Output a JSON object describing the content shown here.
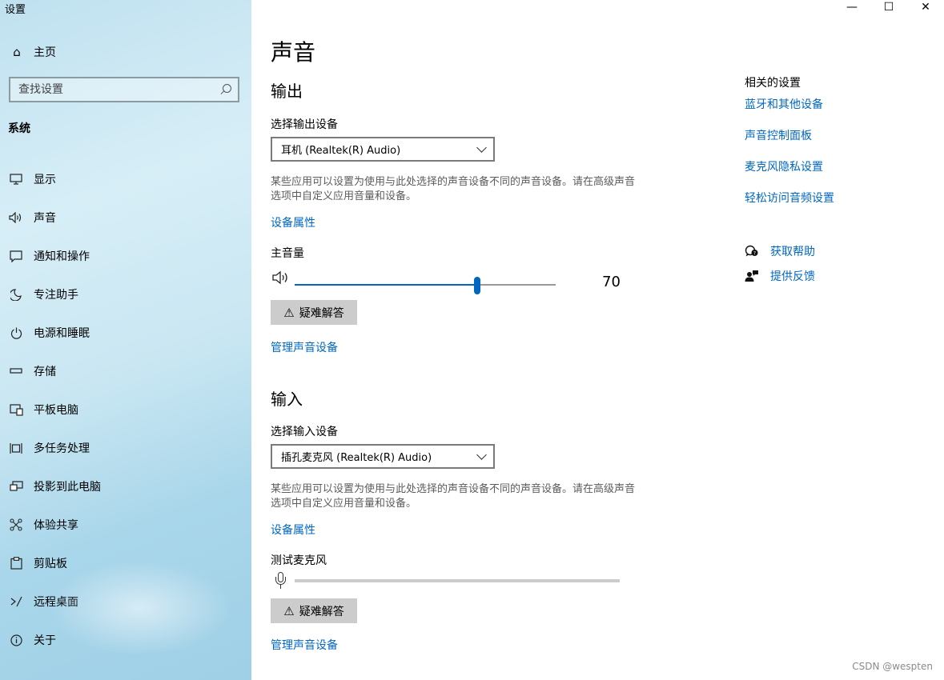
{
  "app_title": "设置",
  "window_controls": {
    "minimize": "—",
    "maximize": "☐",
    "close": "✕"
  },
  "sidebar": {
    "home_label": "主页",
    "search_placeholder": "查找设置",
    "section_label": "系统",
    "items": [
      {
        "label": "显示",
        "icon": "display-icon"
      },
      {
        "label": "声音",
        "icon": "speaker-icon"
      },
      {
        "label": "通知和操作",
        "icon": "notification-icon"
      },
      {
        "label": "专注助手",
        "icon": "moon-icon"
      },
      {
        "label": "电源和睡眠",
        "icon": "power-icon"
      },
      {
        "label": "存储",
        "icon": "storage-icon"
      },
      {
        "label": "平板电脑",
        "icon": "tablet-icon"
      },
      {
        "label": "多任务处理",
        "icon": "multitask-icon"
      },
      {
        "label": "投影到此电脑",
        "icon": "project-icon"
      },
      {
        "label": "体验共享",
        "icon": "share-icon"
      },
      {
        "label": "剪贴板",
        "icon": "clipboard-icon"
      },
      {
        "label": "远程桌面",
        "icon": "remote-icon"
      },
      {
        "label": "关于",
        "icon": "info-icon"
      }
    ]
  },
  "main": {
    "title": "声音",
    "output": {
      "heading": "输出",
      "device_label": "选择输出设备",
      "device_value": "耳机 (Realtek(R) Audio)",
      "desc": "某些应用可以设置为使用与此处选择的声音设备不同的声音设备。请在高级声音选项中自定义应用音量和设备。",
      "properties_link": "设备属性",
      "volume_label": "主音量",
      "volume_value": "70",
      "volume_percent": 70,
      "troubleshoot": "疑难解答",
      "manage_link": "管理声音设备"
    },
    "input": {
      "heading": "输入",
      "device_label": "选择输入设备",
      "device_value": "插孔麦克风 (Realtek(R) Audio)",
      "desc": "某些应用可以设置为使用与此处选择的声音设备不同的声音设备。请在高级声音选项中自定义应用音量和设备。",
      "properties_link": "设备属性",
      "test_label": "测试麦克风",
      "mic_level_percent": 0,
      "troubleshoot": "疑难解答",
      "manage_link": "管理声音设备"
    }
  },
  "related": {
    "title": "相关的设置",
    "links": [
      "蓝牙和其他设备",
      "声音控制面板",
      "麦克风隐私设置",
      "轻松访问音频设置"
    ],
    "help": "获取帮助",
    "feedback": "提供反馈"
  },
  "watermark": "CSDN @wespten",
  "colors": {
    "accent": "#0067c0",
    "button_bg": "#cccccc"
  }
}
